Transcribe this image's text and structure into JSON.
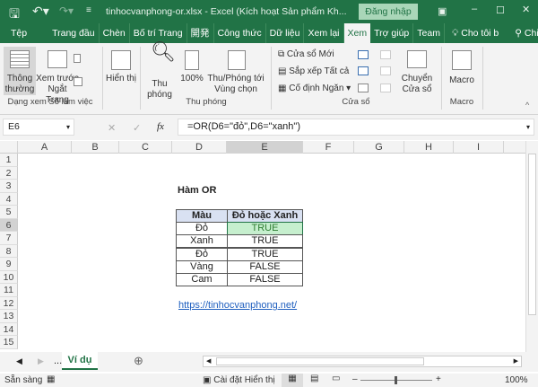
{
  "titlebar": {
    "filename": "tinhocvanphong-or.xlsx",
    "separator": "-",
    "app": "Excel (Kích hoạt Sản phẩm Kh...",
    "login": "Đăng nhập"
  },
  "tabs": [
    "Tệp",
    "Trang đầu",
    "Chèn",
    "Bố trí Trang",
    "開発",
    "Công thức",
    "Dữ liệu",
    "Xem lại",
    "Xem",
    "Trợ giúp",
    "Team",
    "Cho tôi b",
    "Chia sẻ"
  ],
  "ribbon": {
    "normal": "Thông thường",
    "pagebreak": "Xem trước Ngắt Trang",
    "show": "Hiển thị",
    "zoom": "Thu phóng",
    "zoom100": "100%",
    "zoomsel": "Thu/Phóng tới Vùng chọn",
    "newwin": "Cửa sổ Mới",
    "arrange": "Sắp xếp Tất cả",
    "freeze": "Cố định Ngăn",
    "switch": "Chuyển Cửa sổ",
    "macro": "Macro",
    "groups": {
      "views": "Dạng xem Sổ làm việc",
      "zoom": "Thu phóng",
      "window": "Cửa sổ",
      "macros": "Macro"
    }
  },
  "formula": {
    "namebox": "E6",
    "fx": "fx",
    "value": "=OR(D6=\"đỏ\",D6=\"xanh\")"
  },
  "columns": [
    "A",
    "B",
    "C",
    "D",
    "E",
    "F",
    "G",
    "H",
    "I"
  ],
  "rows": [
    "1",
    "2",
    "3",
    "4",
    "5",
    "6",
    "7",
    "8",
    "9",
    "10",
    "11",
    "12",
    "13",
    "14",
    "15"
  ],
  "sheet": {
    "title": "Hàm OR",
    "headers": [
      "Màu",
      "Đỏ hoặc Xanh"
    ],
    "data": [
      [
        "Đỏ",
        "TRUE"
      ],
      [
        "Xanh",
        "TRUE"
      ],
      [
        "Đỏ",
        "TRUE"
      ],
      [
        "Vàng",
        "FALSE"
      ],
      [
        "Cam",
        "FALSE"
      ]
    ],
    "link": "https://tinhocvanphong.net/"
  },
  "sheettabs": {
    "more": "...",
    "active": "Ví dụ"
  },
  "status": {
    "ready": "Sẵn sàng",
    "display": "Cài đặt Hiển thị",
    "zoom": "100%"
  },
  "colors": {
    "excel_green": "#217346",
    "header_fill": "#d9e1f2",
    "selected_fill": "#c6efce"
  }
}
